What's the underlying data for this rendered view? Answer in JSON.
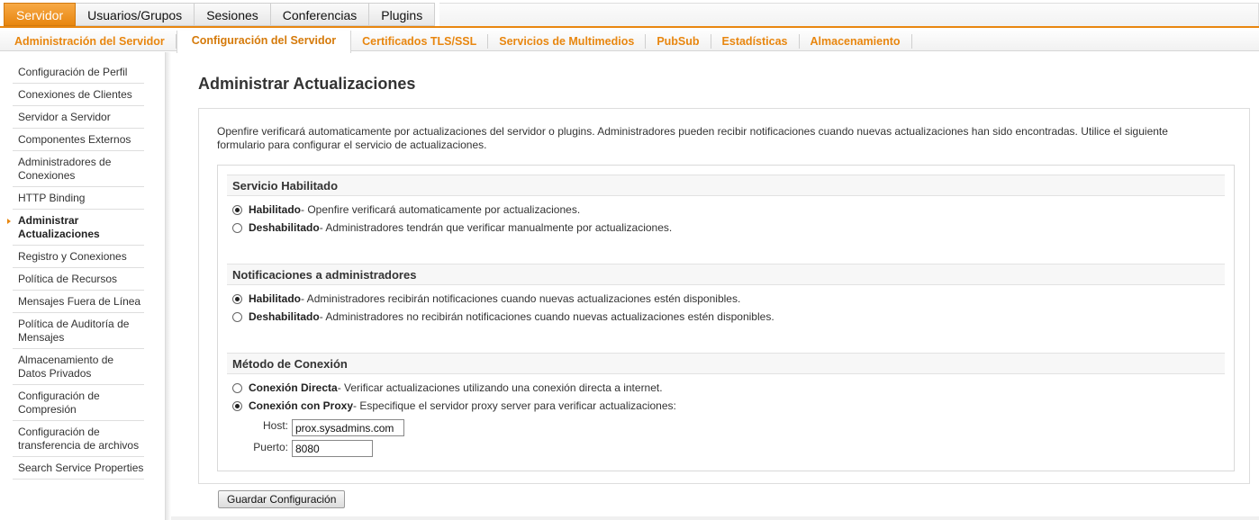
{
  "top_tabs": [
    {
      "label": "Servidor",
      "active": true
    },
    {
      "label": "Usuarios/Grupos"
    },
    {
      "label": "Sesiones"
    },
    {
      "label": "Conferencias"
    },
    {
      "label": "Plugins"
    }
  ],
  "sub_tabs": [
    {
      "label": "Administración del Servidor"
    },
    {
      "label": "Configuración del Servidor",
      "active": true
    },
    {
      "label": "Certificados TLS/SSL"
    },
    {
      "label": "Servicios de Multimedios"
    },
    {
      "label": "PubSub"
    },
    {
      "label": "Estadísticas"
    },
    {
      "label": "Almacenamiento"
    }
  ],
  "sidebar": {
    "items": [
      {
        "label": "Configuración de Perfil"
      },
      {
        "label": "Conexiones de Clientes"
      },
      {
        "label": "Servidor a Servidor"
      },
      {
        "label": "Componentes Externos"
      },
      {
        "label": "Administradores de Conexiones"
      },
      {
        "label": "HTTP Binding"
      },
      {
        "label": "Administrar Actualizaciones",
        "active": true
      },
      {
        "label": "Registro y Conexiones"
      },
      {
        "label": "Política de Recursos"
      },
      {
        "label": "Mensajes Fuera de Línea"
      },
      {
        "label": "Política de Auditoría de Mensajes"
      },
      {
        "label": "Almacenamiento de Datos Privados"
      },
      {
        "label": "Configuración de Compresión"
      },
      {
        "label": "Configuración de transferencia de archivos"
      },
      {
        "label": "Search Service Properties"
      }
    ]
  },
  "main": {
    "title": "Administrar Actualizaciones",
    "intro": "Openfire verificará automaticamente por actualizaciones del servidor o plugins. Administradores pueden recibir notificaciones cuando nuevas actualizaciones han sido encontradas. Utilice el siguiente formulario para configurar el servicio de actualizaciones.",
    "sections": [
      {
        "heading": "Servicio Habilitado",
        "options": [
          {
            "bold": "Habilitado",
            "text": " - Openfire verificará automaticamente por actualizaciones.",
            "checked": true
          },
          {
            "bold": "Deshabilitado",
            "text": " - Administradores tendrán que verificar manualmente por actualizaciones.",
            "checked": false
          }
        ]
      },
      {
        "heading": "Notificaciones a administradores",
        "options": [
          {
            "bold": "Habilitado",
            "text": " - Administradores recibirán notificaciones cuando nuevas actualizaciones estén disponibles.",
            "checked": true
          },
          {
            "bold": "Deshabilitado",
            "text": " - Administradores no recibirán notificaciones cuando nuevas actualizaciones estén disponibles.",
            "checked": false
          }
        ]
      },
      {
        "heading": "Método de Conexión",
        "options": [
          {
            "bold": "Conexión Directa",
            "text": " - Verificar actualizaciones utilizando una conexión directa a internet.",
            "checked": false
          },
          {
            "bold": "Conexión con Proxy",
            "text": " - Especifique el servidor proxy server para verificar actualizaciones:",
            "checked": true
          }
        ]
      }
    ],
    "proxy": {
      "host_label": "Host:",
      "host_value": "prox.sysadmins.com",
      "port_label": "Puerto:",
      "port_value": "8080"
    },
    "save_label": "Guardar Configuración"
  }
}
